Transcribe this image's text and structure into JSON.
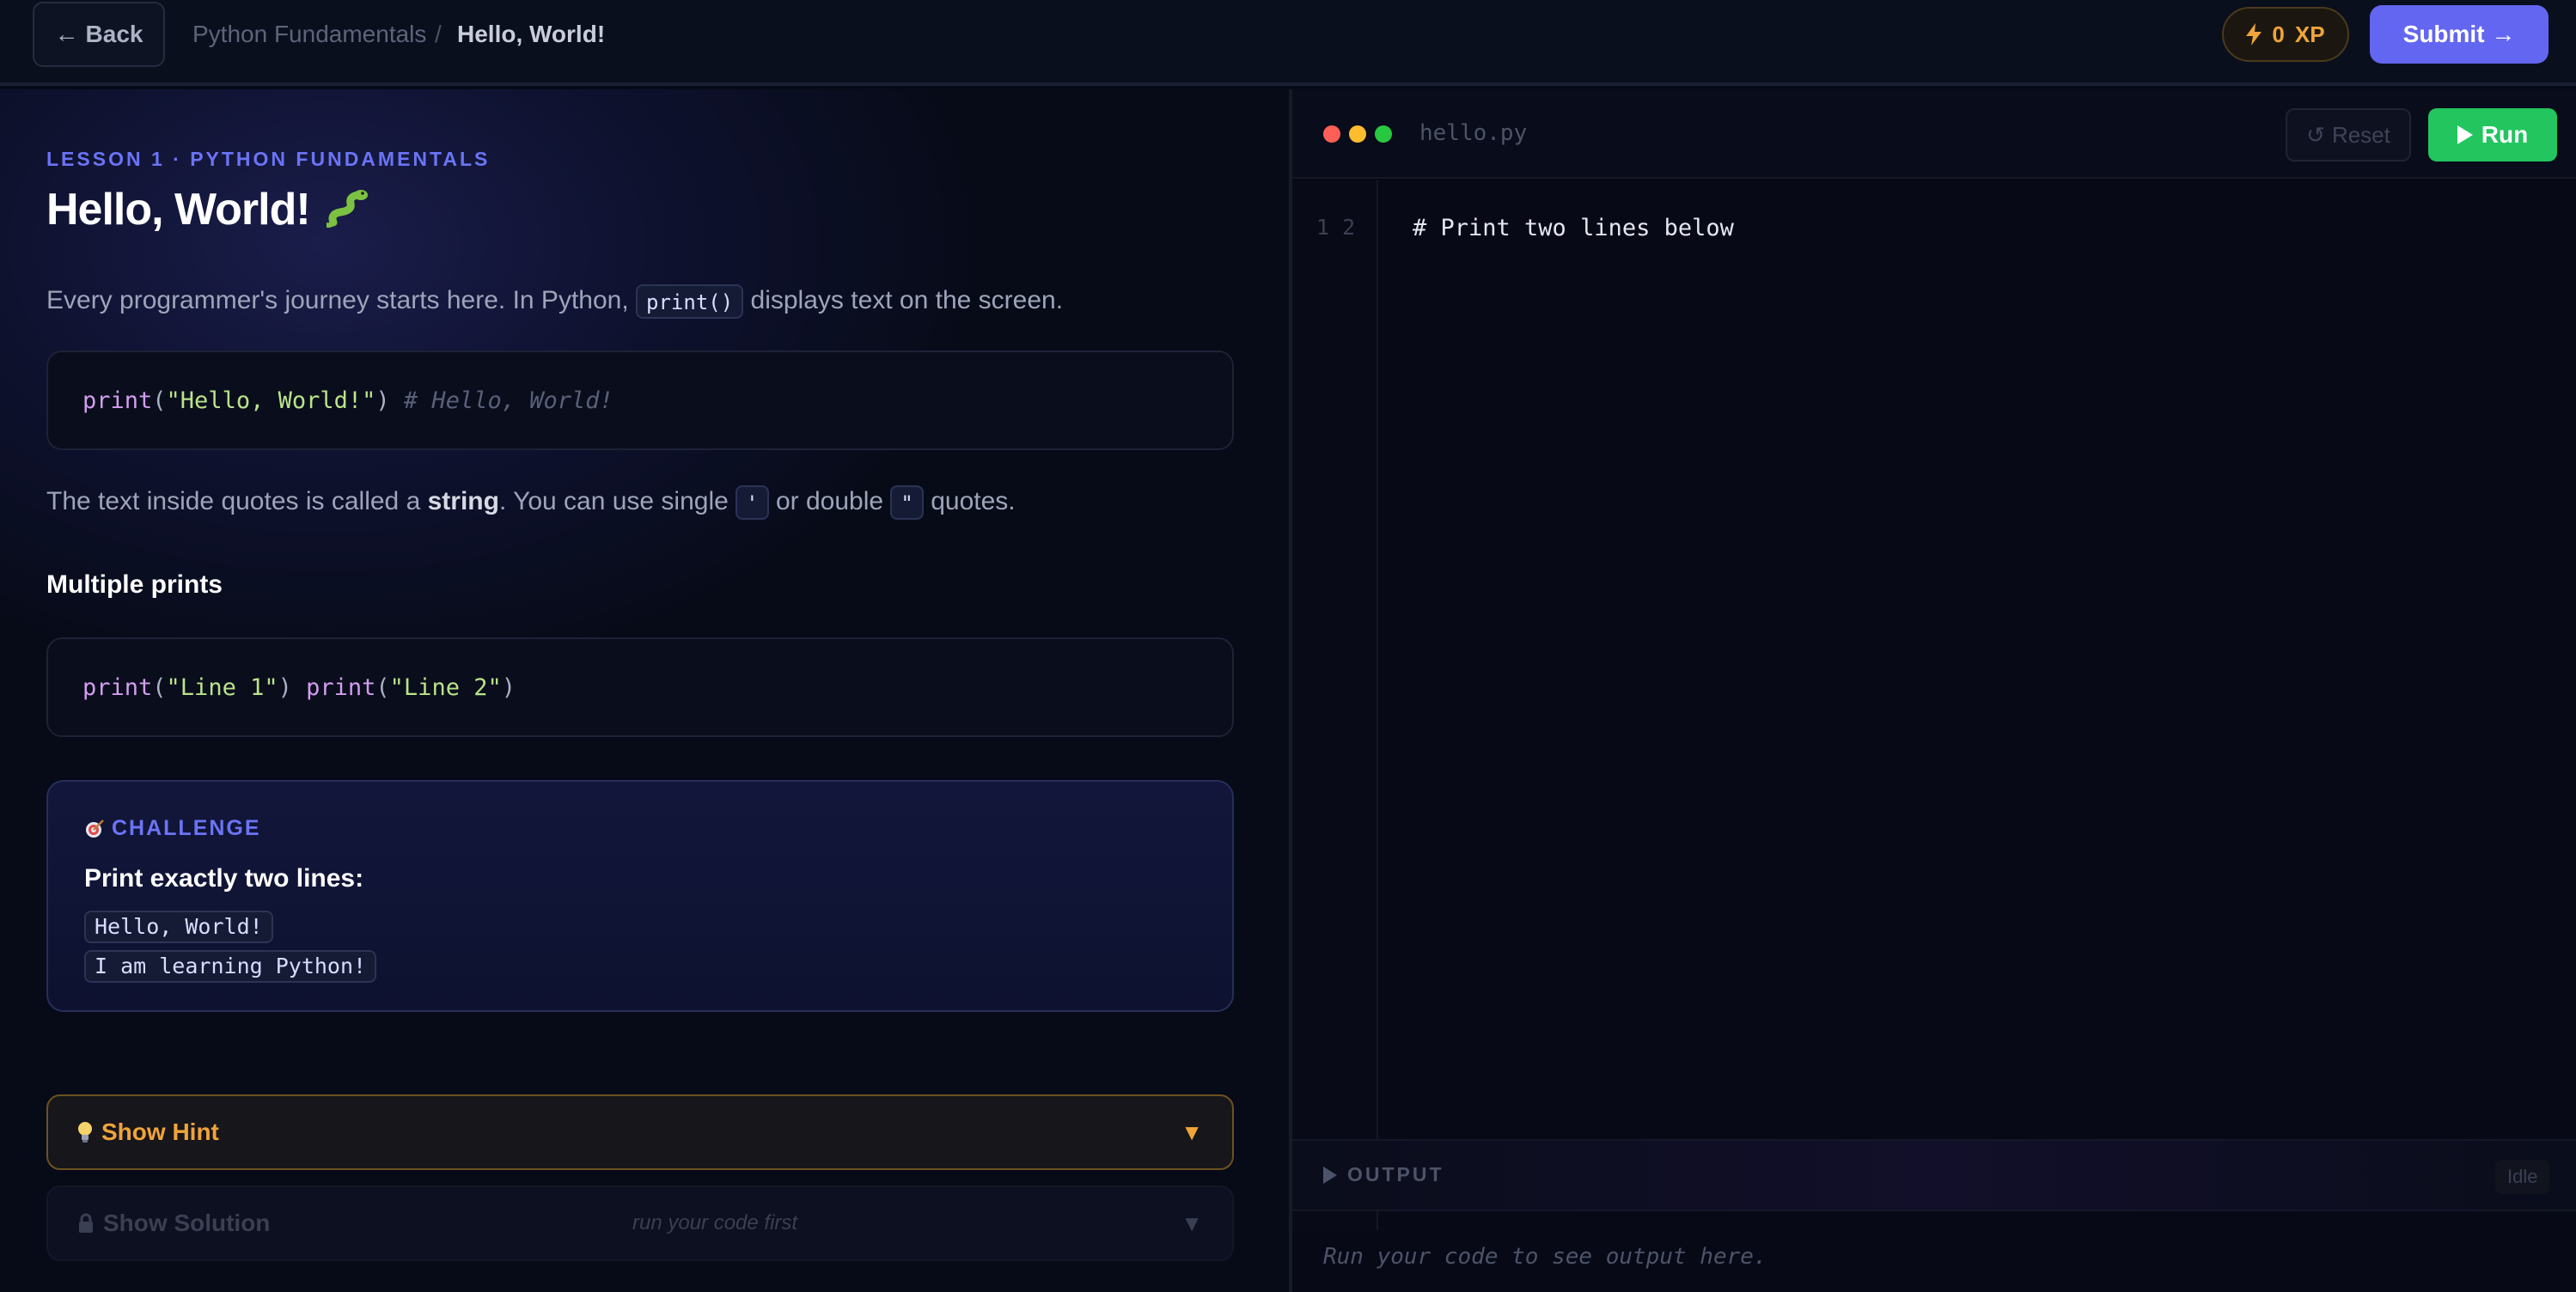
{
  "topbar": {
    "back_label": "Back",
    "breadcrumb_parent": "Python Fundamentals",
    "breadcrumb_separator": "/",
    "breadcrumb_current": "Hello, World!",
    "xp_value": "0",
    "xp_unit": "XP",
    "submit_label": "Submit →"
  },
  "lesson": {
    "tag": "LESSON 1 · PYTHON FUNDAMENTALS",
    "title": "Hello, World!",
    "intro_before": "Every programmer's journey starts here. In Python,",
    "intro_code": "print()",
    "intro_after": "displays text on the screen.",
    "example1": {
      "fn": "print",
      "open": "(",
      "str": "\"Hello, World!\"",
      "close": ")",
      "comment": "# Hello, World!"
    },
    "strings_before": "The text inside quotes is called a",
    "strings_bold": "string",
    "strings_mid": ". You can use single",
    "strings_single": "'",
    "strings_or": "or double",
    "strings_double": "\"",
    "strings_after": "quotes.",
    "subhead": "Multiple prints",
    "example2": {
      "fn1": "print",
      "str1": "\"Line 1\"",
      "fn2": "print",
      "str2": "\"Line 2\""
    },
    "challenge": {
      "tag": "CHALLENGE",
      "text": "Print exactly two lines:",
      "lines": [
        "Hello, World!",
        "I am learning Python!"
      ]
    },
    "hint_label": "Show Hint",
    "solution_label": "Show Solution",
    "solution_note": "run your code first"
  },
  "editor": {
    "filename": "hello.py",
    "reset_label": "Reset",
    "run_label": "Run",
    "line_numbers": "1 2",
    "code": "# Print two lines below",
    "output_label": "OUTPUT",
    "status": "Idle",
    "output_placeholder": "Run your code to see output here."
  },
  "colors": {
    "accent": "#6366f1",
    "run": "#22c55e",
    "xp": "#f0a43a",
    "dot_red": "#ff5f57",
    "dot_yellow": "#febc2e",
    "dot_green": "#28c840"
  },
  "icons": {
    "lesson_emoji": "snake-icon",
    "challenge": "target-icon",
    "hint": "lightbulb-icon",
    "solution": "lock-icon"
  }
}
